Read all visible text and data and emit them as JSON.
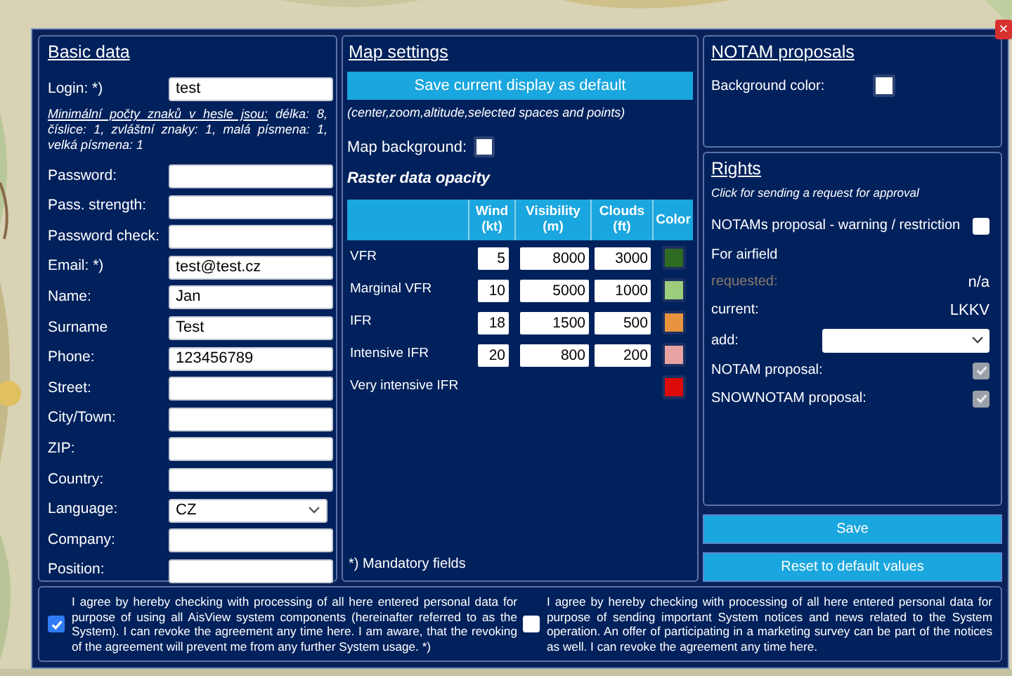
{
  "close_button": "×",
  "basic_data": {
    "title": "Basic data",
    "login": {
      "label": "Login: *)",
      "value": "test"
    },
    "hint_lead": "Minimální počty znaků v hesle jsou:",
    "hint_rest": "délka: 8, číslice: 1, zvláštní znaky: 1, malá písmena: 1, velká písmena: 1",
    "fields": [
      {
        "label": "Password:",
        "kind": "text"
      },
      {
        "label": "Pass. strength:",
        "kind": "text"
      },
      {
        "label": "Password check:",
        "kind": "text"
      },
      {
        "label": "Email: *)",
        "value": "test@test.cz",
        "kind": "text"
      },
      {
        "label": "Name:",
        "value": "Jan",
        "kind": "text"
      },
      {
        "label": "Surname",
        "value": "Test",
        "kind": "text"
      },
      {
        "label": "Phone:",
        "value": "123456789",
        "kind": "text"
      },
      {
        "label": "Street:",
        "kind": "text"
      },
      {
        "label": "City/Town:",
        "kind": "text"
      },
      {
        "label": "ZIP:",
        "kind": "text"
      },
      {
        "label": "Country:",
        "kind": "text"
      },
      {
        "label": "Language:",
        "value": "CZ",
        "kind": "select"
      },
      {
        "label": "Company:",
        "kind": "text"
      },
      {
        "label": "Position:",
        "kind": "text"
      }
    ]
  },
  "map_settings": {
    "title": "Map settings",
    "save_button": "Save current display as default",
    "save_note": "(center,zoom,altitude,selected spaces and points)",
    "map_background": "Map background:",
    "raster_title": "Raster data opacity",
    "table": {
      "columns": [
        "Wind (kt)",
        "Visibility (m)",
        "Clouds (ft)",
        "Color"
      ],
      "rows": [
        {
          "name": "VFR",
          "wind": "5",
          "visibility": "8000",
          "clouds": "3000",
          "color": "#2f6b22"
        },
        {
          "name": "Marginal VFR",
          "wind": "10",
          "visibility": "5000",
          "clouds": "1000",
          "color": "#9ccc7c"
        },
        {
          "name": "IFR",
          "wind": "18",
          "visibility": "1500",
          "clouds": "500",
          "color": "#e8933e"
        },
        {
          "name": "Intensive IFR",
          "wind": "20",
          "visibility": "800",
          "clouds": "200",
          "color": "#e8a3a3"
        },
        {
          "name": "Very intensive IFR",
          "color": "#dd0a0a"
        }
      ]
    },
    "mandatory_note": "*) Mandatory fields"
  },
  "notam_proposals": {
    "title": "NOTAM proposals",
    "background_color": "Background color:"
  },
  "rights": {
    "title": "Rights",
    "note": "Click for sending a request for approval",
    "items": [
      {
        "kind": "checkbox",
        "label": "NOTAMs proposal - warning / restriction",
        "checked": false,
        "disabled": false
      },
      {
        "kind": "heading",
        "label": "For airfield"
      },
      {
        "kind": "value",
        "label": "requested:",
        "value": "n/a",
        "disabled": true
      },
      {
        "kind": "value",
        "label": "current:",
        "value": "LKKV",
        "disabled": false
      },
      {
        "kind": "select",
        "label": "add:"
      },
      {
        "kind": "checkbox",
        "label": "NOTAM proposal:",
        "checked": true,
        "disabled": true
      },
      {
        "kind": "checkbox",
        "label": "SNOWNOTAM proposal:",
        "checked": true,
        "disabled": true
      }
    ]
  },
  "buttons": [
    "Save",
    "Reset to default values"
  ],
  "consents": [
    {
      "text": "I agree by hereby checking with processing of all here entered personal data for purpose of using all AisView system components (hereinafter referred to as the System). I can revoke the agreement any time here. I am aware, that the revoking of the agreement will prevent me from any further System usage. *)",
      "checked": true
    },
    {
      "text": "I agree by hereby checking with processing of all here entered personal data for purpose of sending important System notices and news related to the System operation. An offer of participating in a marketing survey can be part of the notices as well. I can revoke the agreement any time here.",
      "checked": false
    }
  ]
}
